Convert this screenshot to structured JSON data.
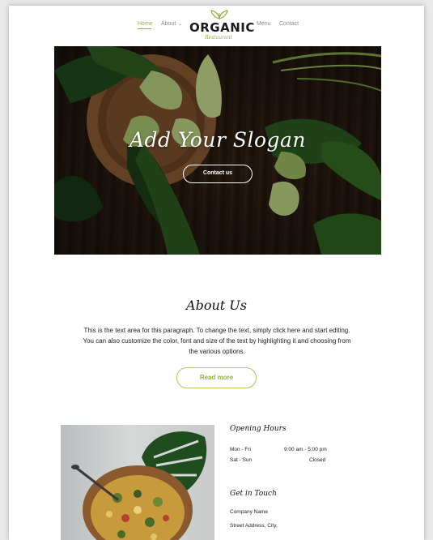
{
  "nav": {
    "home": "Home",
    "about": "About",
    "menu": "Menu",
    "contact": "Contact",
    "logo_word": "ORGANIC",
    "logo_sub": "Restaurant"
  },
  "hero": {
    "slogan": "Add Your Slogan",
    "button": "Contact us"
  },
  "about": {
    "title": "About Us",
    "line1": "This is the text area for this paragraph. To change the text, simply click here and start editing.",
    "line2": "You can also customize the color, font and size of the text by highlighting it and choosing from",
    "line3": "the various options.",
    "button": "Read more"
  },
  "hours": {
    "title": "Opening Hours",
    "rows": [
      {
        "day": "Mon - Fri",
        "time": "9:00 am - 5:00 pm"
      },
      {
        "day": "Sat - Sun",
        "time": "Closed"
      }
    ]
  },
  "touch": {
    "title": "Get in Touch",
    "company": "Company Name",
    "street": "Street Address, City,"
  },
  "colors": {
    "accent": "#8cb33e",
    "dark": "#1a1a1a"
  }
}
